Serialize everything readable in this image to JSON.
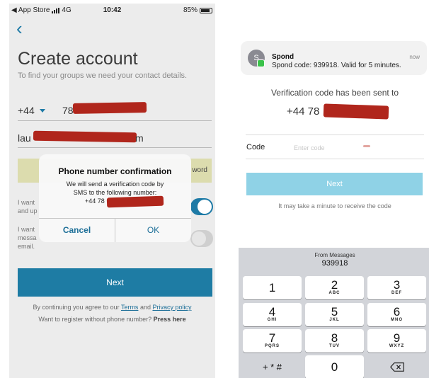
{
  "left": {
    "statusbar": {
      "carrier": "◀ App Store",
      "network": "4G",
      "time": "10:42",
      "battery": "85%"
    },
    "title": "Create account",
    "subtitle": "To find your groups we need your contact details.",
    "country_code": "+44",
    "phone_visible": "78",
    "email_prefix": "lau",
    "email_suffix": "m",
    "yellow_label": "word",
    "toggle1": {
      "line1": "I want",
      "line2": "and up",
      "on": true
    },
    "toggle2": {
      "line1": "I want",
      "line2": "messa",
      "line3": "email.",
      "on": false
    },
    "next_label": "Next",
    "agree_prefix": "By continuing you agree to our ",
    "terms": "Terms",
    "and": " and ",
    "privacy": "Privacy policy",
    "noreg_text": "Want to register without phone number? ",
    "noreg_link": "Press here",
    "dialog": {
      "title": "Phone number confirmation",
      "msg1": "We will send a verification code by",
      "msg2": "SMS to the following number:",
      "number": "+44 78",
      "cancel": "Cancel",
      "ok": "OK"
    }
  },
  "right": {
    "notification": {
      "avatar": "S",
      "app": "Spond",
      "time": "now",
      "body": "Spond code: 939918. Valid for 5 minutes."
    },
    "sent_text": "Verification code has been sent to",
    "number": "+44 78",
    "code_label": "Code",
    "code_placeholder": "Enter code",
    "next_label": "Next",
    "may_take": "It may take a minute to receive the code",
    "keyboard": {
      "suggestion_from": "From Messages",
      "suggestion_code": "939918",
      "keys": [
        {
          "digit": "1",
          "letters": ""
        },
        {
          "digit": "2",
          "letters": "ABC"
        },
        {
          "digit": "3",
          "letters": "DEF"
        },
        {
          "digit": "4",
          "letters": "GHI"
        },
        {
          "digit": "5",
          "letters": "JKL"
        },
        {
          "digit": "6",
          "letters": "MNO"
        },
        {
          "digit": "7",
          "letters": "PQRS"
        },
        {
          "digit": "8",
          "letters": "TUV"
        },
        {
          "digit": "9",
          "letters": "WXYZ"
        },
        {
          "digit": "+ * #",
          "letters": ""
        },
        {
          "digit": "0",
          "letters": ""
        }
      ]
    }
  },
  "colors": {
    "accent": "#1e7ca4",
    "next_disabled": "#8fd2e6",
    "redaction": "#b0261c"
  }
}
